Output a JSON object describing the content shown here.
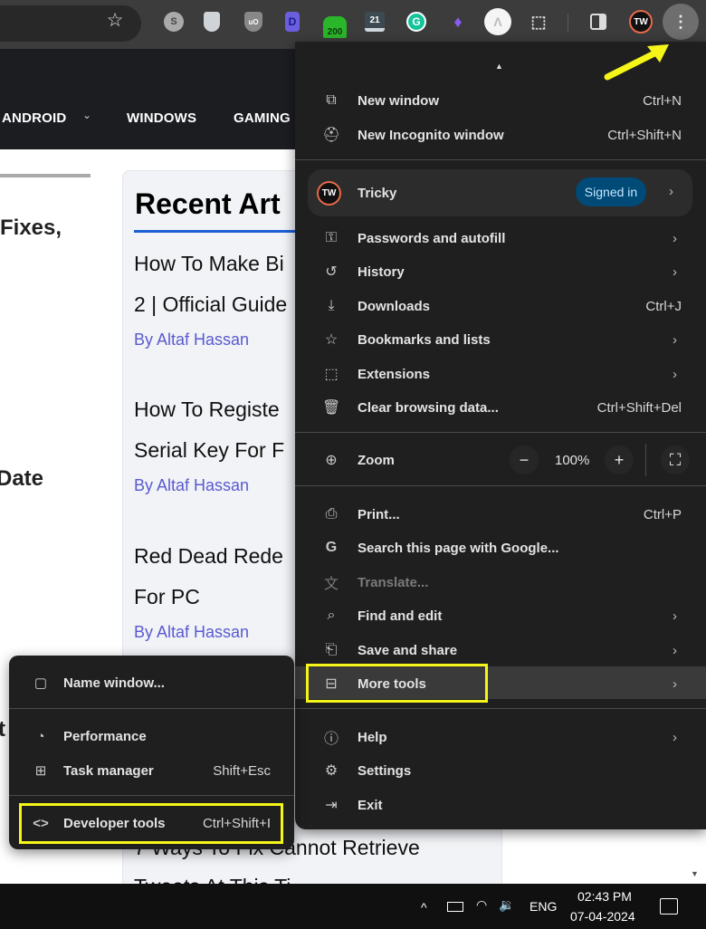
{
  "toolbar": {
    "bookmark_icon": "star-icon",
    "extensions": [
      {
        "name": "simplenote-extension",
        "label": ""
      },
      {
        "name": "shield-extension",
        "label": ""
      },
      {
        "name": "ublock-origin-extension",
        "label": "uO"
      },
      {
        "name": "d-extension",
        "label": "D"
      },
      {
        "name": "counter-extension",
        "label": "200"
      },
      {
        "name": "calendar-extension",
        "label": "21"
      },
      {
        "name": "grammarly-extension",
        "label": "G"
      },
      {
        "name": "flame-extension",
        "label": "🔥"
      },
      {
        "name": "arc-extension",
        "label": "Λ"
      },
      {
        "name": "extensions-puzzle",
        "label": "⬚"
      }
    ],
    "profile_initials": "TW",
    "menu_icon": "⋮"
  },
  "site": {
    "nav": [
      {
        "label": "ANDROID",
        "has_dropdown": true
      },
      {
        "label": "WINDOWS"
      },
      {
        "label": "GAMING"
      }
    ],
    "left_fragments": [
      "Fixes,",
      "Date",
      "t"
    ],
    "sidebar": {
      "title": "Recent Articles",
      "title_visible": "Recent Art",
      "articles": [
        {
          "lines": [
            "How To Make Bi",
            "2 | Official Guide"
          ],
          "author": "By Altaf Hassan"
        },
        {
          "lines": [
            "How To Registe",
            "Serial Key For F"
          ],
          "author": "By Altaf Hassan"
        },
        {
          "lines": [
            "Red Dead Rede",
            "For PC"
          ],
          "author": "By Altaf Hassan"
        },
        {
          "lines": [
            "7 Ways To Fix Cannot Retrieve",
            "Tweets At This Ti"
          ],
          "author": ""
        }
      ]
    }
  },
  "menu": {
    "items_top": [
      {
        "icon": "new-window-icon",
        "glyph": "➕",
        "label": "New window",
        "shortcut": "Ctrl+N"
      },
      {
        "icon": "incognito-icon",
        "glyph": "🕶",
        "label": "New Incognito window",
        "shortcut": "Ctrl+Shift+N"
      }
    ],
    "profile": {
      "initials": "TW",
      "name": "Tricky",
      "status": "Signed in"
    },
    "items_mid": [
      {
        "icon": "key-icon",
        "glyph": "⚿",
        "label": "Passwords and autofill",
        "submenu": true
      },
      {
        "icon": "history-icon",
        "glyph": "⟲",
        "label": "History",
        "submenu": true
      },
      {
        "icon": "download-icon",
        "glyph": "⤓",
        "label": "Downloads",
        "shortcut": "Ctrl+J"
      },
      {
        "icon": "star-icon",
        "glyph": "☆",
        "label": "Bookmarks and lists",
        "submenu": true
      },
      {
        "icon": "puzzle-icon",
        "glyph": "⬚",
        "label": "Extensions",
        "submenu": true
      },
      {
        "icon": "trash-icon",
        "glyph": "🗑",
        "label": "Clear browsing data...",
        "shortcut": "Ctrl+Shift+Del"
      }
    ],
    "zoom": {
      "label": "Zoom",
      "value": "100%",
      "minus": "−",
      "plus": "+",
      "fullscreen": "⛶"
    },
    "items_tools": [
      {
        "icon": "print-icon",
        "glyph": "🖨",
        "label": "Print...",
        "shortcut": "Ctrl+P"
      },
      {
        "icon": "google-icon",
        "glyph": "G",
        "label": "Search this page with Google..."
      },
      {
        "icon": "translate-icon",
        "glyph": "文",
        "label": "Translate...",
        "disabled": true
      },
      {
        "icon": "find-icon",
        "glyph": "🔍",
        "label": "Find and edit",
        "submenu": true
      },
      {
        "icon": "save-share-icon",
        "glyph": "📄",
        "label": "Save and share",
        "submenu": true
      },
      {
        "icon": "toolbox-icon",
        "glyph": "🧰",
        "label": "More tools",
        "submenu": true,
        "highlighted": true
      }
    ],
    "items_bottom": [
      {
        "icon": "help-icon",
        "glyph": "?",
        "label": "Help",
        "submenu": true
      },
      {
        "icon": "settings-icon",
        "glyph": "⚙",
        "label": "Settings"
      },
      {
        "icon": "exit-icon",
        "glyph": "⇥",
        "label": "Exit"
      }
    ],
    "chevron": "›"
  },
  "submenu": {
    "items": [
      {
        "icon": "window-icon",
        "glyph": "▢",
        "label": "Name window..."
      },
      {
        "icon": "performance-icon",
        "glyph": "◔",
        "label": "Performance"
      },
      {
        "icon": "task-manager-icon",
        "glyph": "⊞",
        "label": "Task manager",
        "shortcut": "Shift+Esc"
      },
      {
        "icon": "code-icon",
        "glyph": "<>",
        "label": "Developer tools",
        "shortcut": "Ctrl+Shift+I",
        "highlighted": true
      }
    ]
  },
  "taskbar": {
    "tray_chevron": "^",
    "battery": "▭",
    "wifi": "◠",
    "volume": "🔉",
    "language": "ENG",
    "time": "02:43 PM",
    "date": "07-04-2024"
  },
  "colors": {
    "highlight": "#f5f51a",
    "signed_in_bg": "#004a77",
    "menu_bg": "#1f1f1f",
    "link": "#5a5ad0"
  }
}
